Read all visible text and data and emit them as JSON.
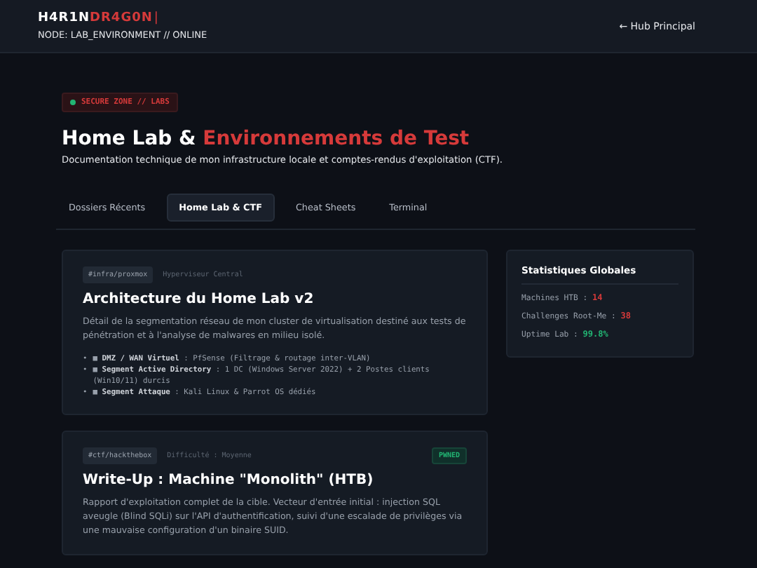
{
  "header": {
    "logo_part1": "H4R1N",
    "logo_part2": "DR4G0N",
    "logo_cursor": "|",
    "node": "NODE: LAB_ENVIRONMENT // ONLINE",
    "hub_link": "← Hub Principal"
  },
  "hero": {
    "badge": "SECURE ZONE // LABS",
    "title_part1": "Home Lab & ",
    "title_part2": "Environnements de Test",
    "subtitle": "Documentation technique de mon infrastructure locale et comptes-rendus d'exploitation (CTF)."
  },
  "tabs": [
    {
      "label": "Dossiers Récents",
      "selected": false
    },
    {
      "label": "Home Lab & CTF",
      "selected": true
    },
    {
      "label": "Cheat Sheets",
      "selected": false
    },
    {
      "label": "Terminal",
      "selected": false
    }
  ],
  "cards": [
    {
      "tag": "#infra/proxmox",
      "meta": "Hyperviseur Central",
      "title": "Architecture du Home Lab v2",
      "description": "Détail de la segmentation réseau de mon cluster de virtualisation destiné aux tests de pénétration et à l'analyse de malwares en milieu isolé.",
      "items": [
        {
          "marker": "•",
          "text": "■ **DMZ / WAN Virtuel** : PfSense (Filtrage & routage inter-VLAN)"
        },
        {
          "marker": "•",
          "text": "■ **Segment Active Directory** : 1 DC (Windows Server 2022) + 2 Postes clients (Win10/11) durcis"
        },
        {
          "marker": "•",
          "text": "■ **Segment Attaque** : Kali Linux & Parrot OS dédiés"
        }
      ]
    },
    {
      "tag": "#ctf/hackthebox",
      "meta": "Difficulté : Moyenne",
      "status": "PWNED",
      "title": "Write-Up : Machine \"Monolith\" (HTB)",
      "description": "Rapport d'exploitation complet de la cible. Vecteur d'entrée initial : injection SQL aveugle (Blind SQLi) sur l'API d'authentification, suivi d'une escalade de privilèges via une mauvaise configuration d'un binaire SUID."
    }
  ],
  "stats": {
    "title": "Statistiques Globales",
    "items": [
      {
        "label": "Machines HTB : ",
        "value": "14",
        "color": "#d63a3a"
      },
      {
        "label": "Challenges Root-Me : ",
        "value": "38",
        "color": "#d63a3a"
      },
      {
        "label": "Uptime Lab : ",
        "value": "99.8%",
        "color": "#22b573"
      }
    ]
  }
}
